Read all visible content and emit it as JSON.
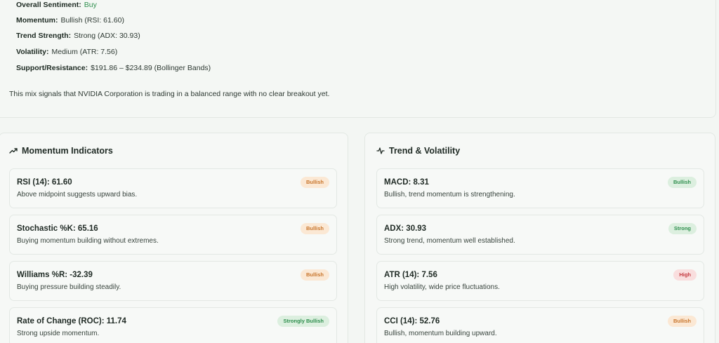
{
  "summary": {
    "lines": [
      {
        "key": "Overall Sentiment:",
        "value": "Buy"
      },
      {
        "key": "Momentum:",
        "value": "Bullish (RSI: 61.60)"
      },
      {
        "key": "Trend Strength:",
        "value": "Strong (ADX: 30.93)"
      },
      {
        "key": "Volatility:",
        "value": "Medium (ATR: 7.56)"
      },
      {
        "key": "Support/Resistance:",
        "value": "$191.86 – $234.89 (Bollinger Bands)"
      }
    ],
    "mix_text": "This mix signals that NVIDIA Corporation is trading in a balanced range with no clear breakout yet.",
    "buy_color": "#2f8f4e"
  },
  "momentum": {
    "title": "Momentum Indicators",
    "icon": "trending-up-icon",
    "items": [
      {
        "title": "RSI (14): 61.60",
        "desc": "Above midpoint suggests upward bias.",
        "badge": "Bullish",
        "tone": "orange"
      },
      {
        "title": "Stochastic %K: 65.16",
        "desc": "Buying momentum building without extremes.",
        "badge": "Bullish",
        "tone": "orange"
      },
      {
        "title": "Williams %R: -32.39",
        "desc": "Buying pressure building steadily.",
        "badge": "Bullish",
        "tone": "orange"
      },
      {
        "title": "Rate of Change (ROC): 11.74",
        "desc": "Strong upside momentum.",
        "badge": "Strongly Bullish",
        "tone": "green"
      }
    ]
  },
  "trend": {
    "title": "Trend & Volatility",
    "icon": "activity-pulse-icon",
    "items": [
      {
        "title": "MACD: 8.31",
        "desc": "Bullish, trend momentum is strengthening.",
        "badge": "Bullish",
        "tone": "green"
      },
      {
        "title": "ADX: 30.93",
        "desc": "Strong trend, momentum well established.",
        "badge": "Strong",
        "tone": "green"
      },
      {
        "title": "ATR (14): 7.56",
        "desc": "High volatility, wide price fluctuations.",
        "badge": "High",
        "tone": "red"
      },
      {
        "title": "CCI (14): 52.76",
        "desc": "Bullish, momentum building upward.",
        "badge": "Bullish",
        "tone": "orange"
      }
    ]
  },
  "colors": {
    "accent_green": "#2f8f4e",
    "badge_orange": "#c8752b",
    "badge_red": "#c4393f"
  }
}
